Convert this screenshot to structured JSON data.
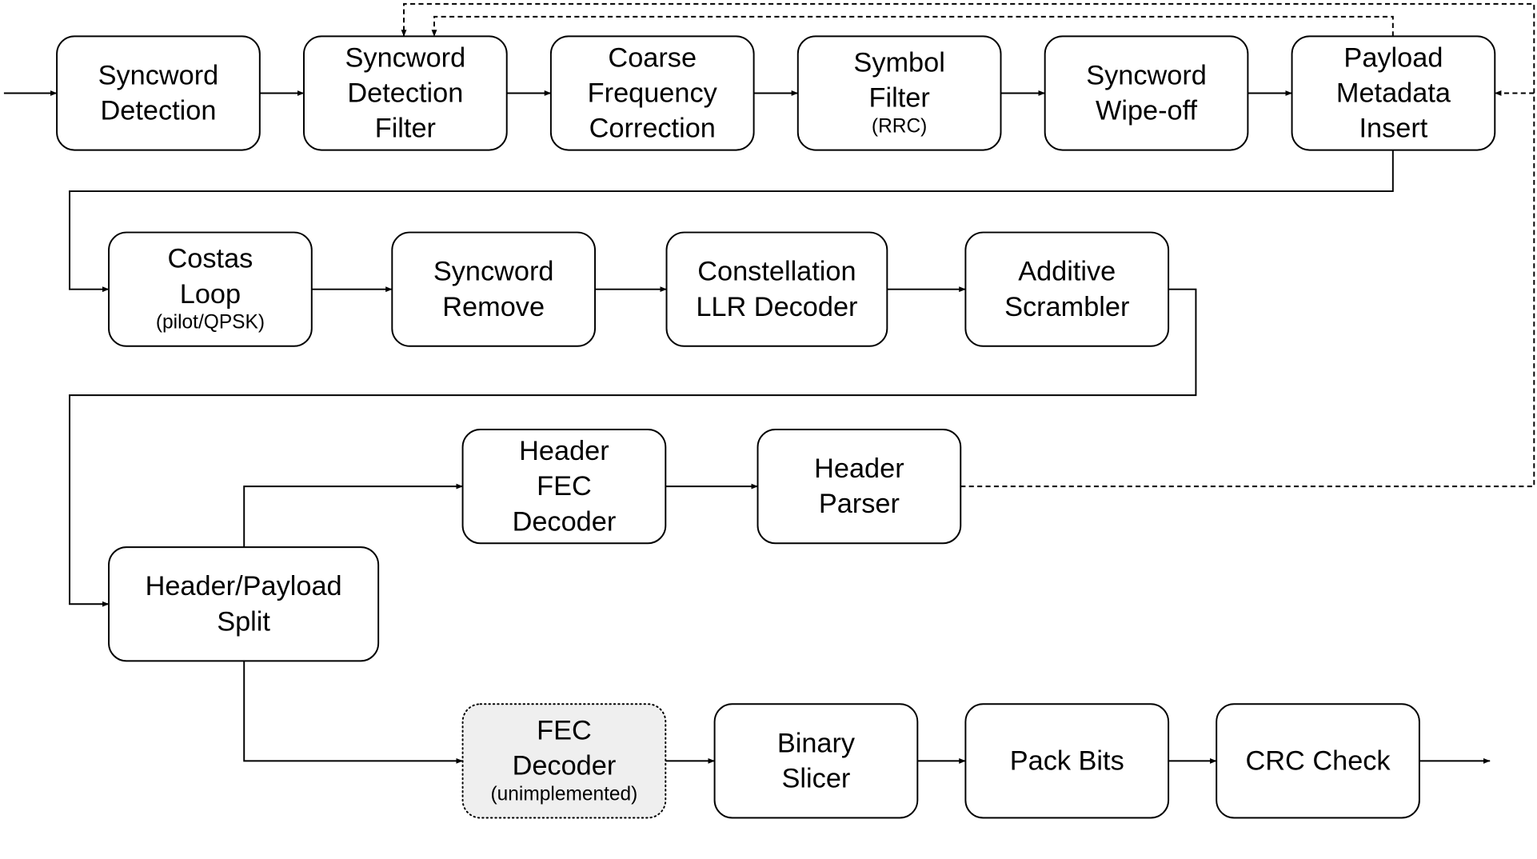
{
  "diagram": {
    "colors": {
      "line": "#000000",
      "box_fill": "#ffffff",
      "unimplemented_fill": "#efefef"
    },
    "blocks": [
      {
        "id": "syncword-detection",
        "lines": [
          "Syncword",
          "Detection"
        ],
        "sub": ""
      },
      {
        "id": "syncword-detection-filter",
        "lines": [
          "Syncword",
          "Detection",
          "Filter"
        ],
        "sub": ""
      },
      {
        "id": "coarse-frequency-correction",
        "lines": [
          "Coarse",
          "Frequency",
          "Correction"
        ],
        "sub": ""
      },
      {
        "id": "symbol-filter",
        "lines": [
          "Symbol",
          "Filter"
        ],
        "sub": "(RRC)"
      },
      {
        "id": "syncword-wipe-off",
        "lines": [
          "Syncword",
          "Wipe-off"
        ],
        "sub": ""
      },
      {
        "id": "payload-metadata-insert",
        "lines": [
          "Payload",
          "Metadata",
          "Insert"
        ],
        "sub": ""
      },
      {
        "id": "costas-loop",
        "lines": [
          "Costas",
          "Loop"
        ],
        "sub": "(pilot/QPSK)"
      },
      {
        "id": "syncword-remove",
        "lines": [
          "Syncword",
          "Remove"
        ],
        "sub": ""
      },
      {
        "id": "constellation-llr-decoder",
        "lines": [
          "Constellation",
          "LLR Decoder"
        ],
        "sub": ""
      },
      {
        "id": "additive-scrambler",
        "lines": [
          "Additive",
          "Scrambler"
        ],
        "sub": ""
      },
      {
        "id": "header-fec-decoder",
        "lines": [
          "Header",
          "FEC",
          "Decoder"
        ],
        "sub": ""
      },
      {
        "id": "header-parser",
        "lines": [
          "Header",
          "Parser"
        ],
        "sub": ""
      },
      {
        "id": "header-payload-split",
        "lines": [
          "Header/Payload",
          "Split"
        ],
        "sub": ""
      },
      {
        "id": "fec-decoder",
        "lines": [
          "FEC",
          "Decoder"
        ],
        "sub": "(unimplemented)",
        "unimplemented": true
      },
      {
        "id": "binary-slicer",
        "lines": [
          "Binary",
          "Slicer"
        ],
        "sub": ""
      },
      {
        "id": "pack-bits",
        "lines": [
          "Pack Bits"
        ],
        "sub": ""
      },
      {
        "id": "crc-check",
        "lines": [
          "CRC Check"
        ],
        "sub": ""
      }
    ],
    "connections": [
      {
        "from": "input",
        "to": "syncword-detection",
        "style": "solid"
      },
      {
        "from": "syncword-detection",
        "to": "syncword-detection-filter",
        "style": "solid"
      },
      {
        "from": "syncword-detection-filter",
        "to": "coarse-frequency-correction",
        "style": "solid"
      },
      {
        "from": "coarse-frequency-correction",
        "to": "symbol-filter",
        "style": "solid"
      },
      {
        "from": "symbol-filter",
        "to": "syncword-wipe-off",
        "style": "solid"
      },
      {
        "from": "syncword-wipe-off",
        "to": "payload-metadata-insert",
        "style": "solid"
      },
      {
        "from": "payload-metadata-insert",
        "to": "costas-loop",
        "style": "solid"
      },
      {
        "from": "costas-loop",
        "to": "syncword-remove",
        "style": "solid"
      },
      {
        "from": "syncword-remove",
        "to": "constellation-llr-decoder",
        "style": "solid"
      },
      {
        "from": "constellation-llr-decoder",
        "to": "additive-scrambler",
        "style": "solid"
      },
      {
        "from": "additive-scrambler",
        "to": "header-payload-split",
        "style": "solid"
      },
      {
        "from": "header-payload-split",
        "to": "header-fec-decoder",
        "style": "solid"
      },
      {
        "from": "header-fec-decoder",
        "to": "header-parser",
        "style": "solid"
      },
      {
        "from": "header-parser",
        "to": "syncword-detection-filter",
        "style": "dashed"
      },
      {
        "from": "header-parser",
        "to": "payload-metadata-insert",
        "style": "dashed"
      },
      {
        "from": "payload-metadata-insert",
        "to": "syncword-detection-filter",
        "style": "dashed"
      },
      {
        "from": "header-payload-split",
        "to": "fec-decoder",
        "style": "solid"
      },
      {
        "from": "fec-decoder",
        "to": "binary-slicer",
        "style": "solid"
      },
      {
        "from": "binary-slicer",
        "to": "pack-bits",
        "style": "solid"
      },
      {
        "from": "pack-bits",
        "to": "crc-check",
        "style": "solid"
      },
      {
        "from": "crc-check",
        "to": "output",
        "style": "solid"
      }
    ]
  }
}
